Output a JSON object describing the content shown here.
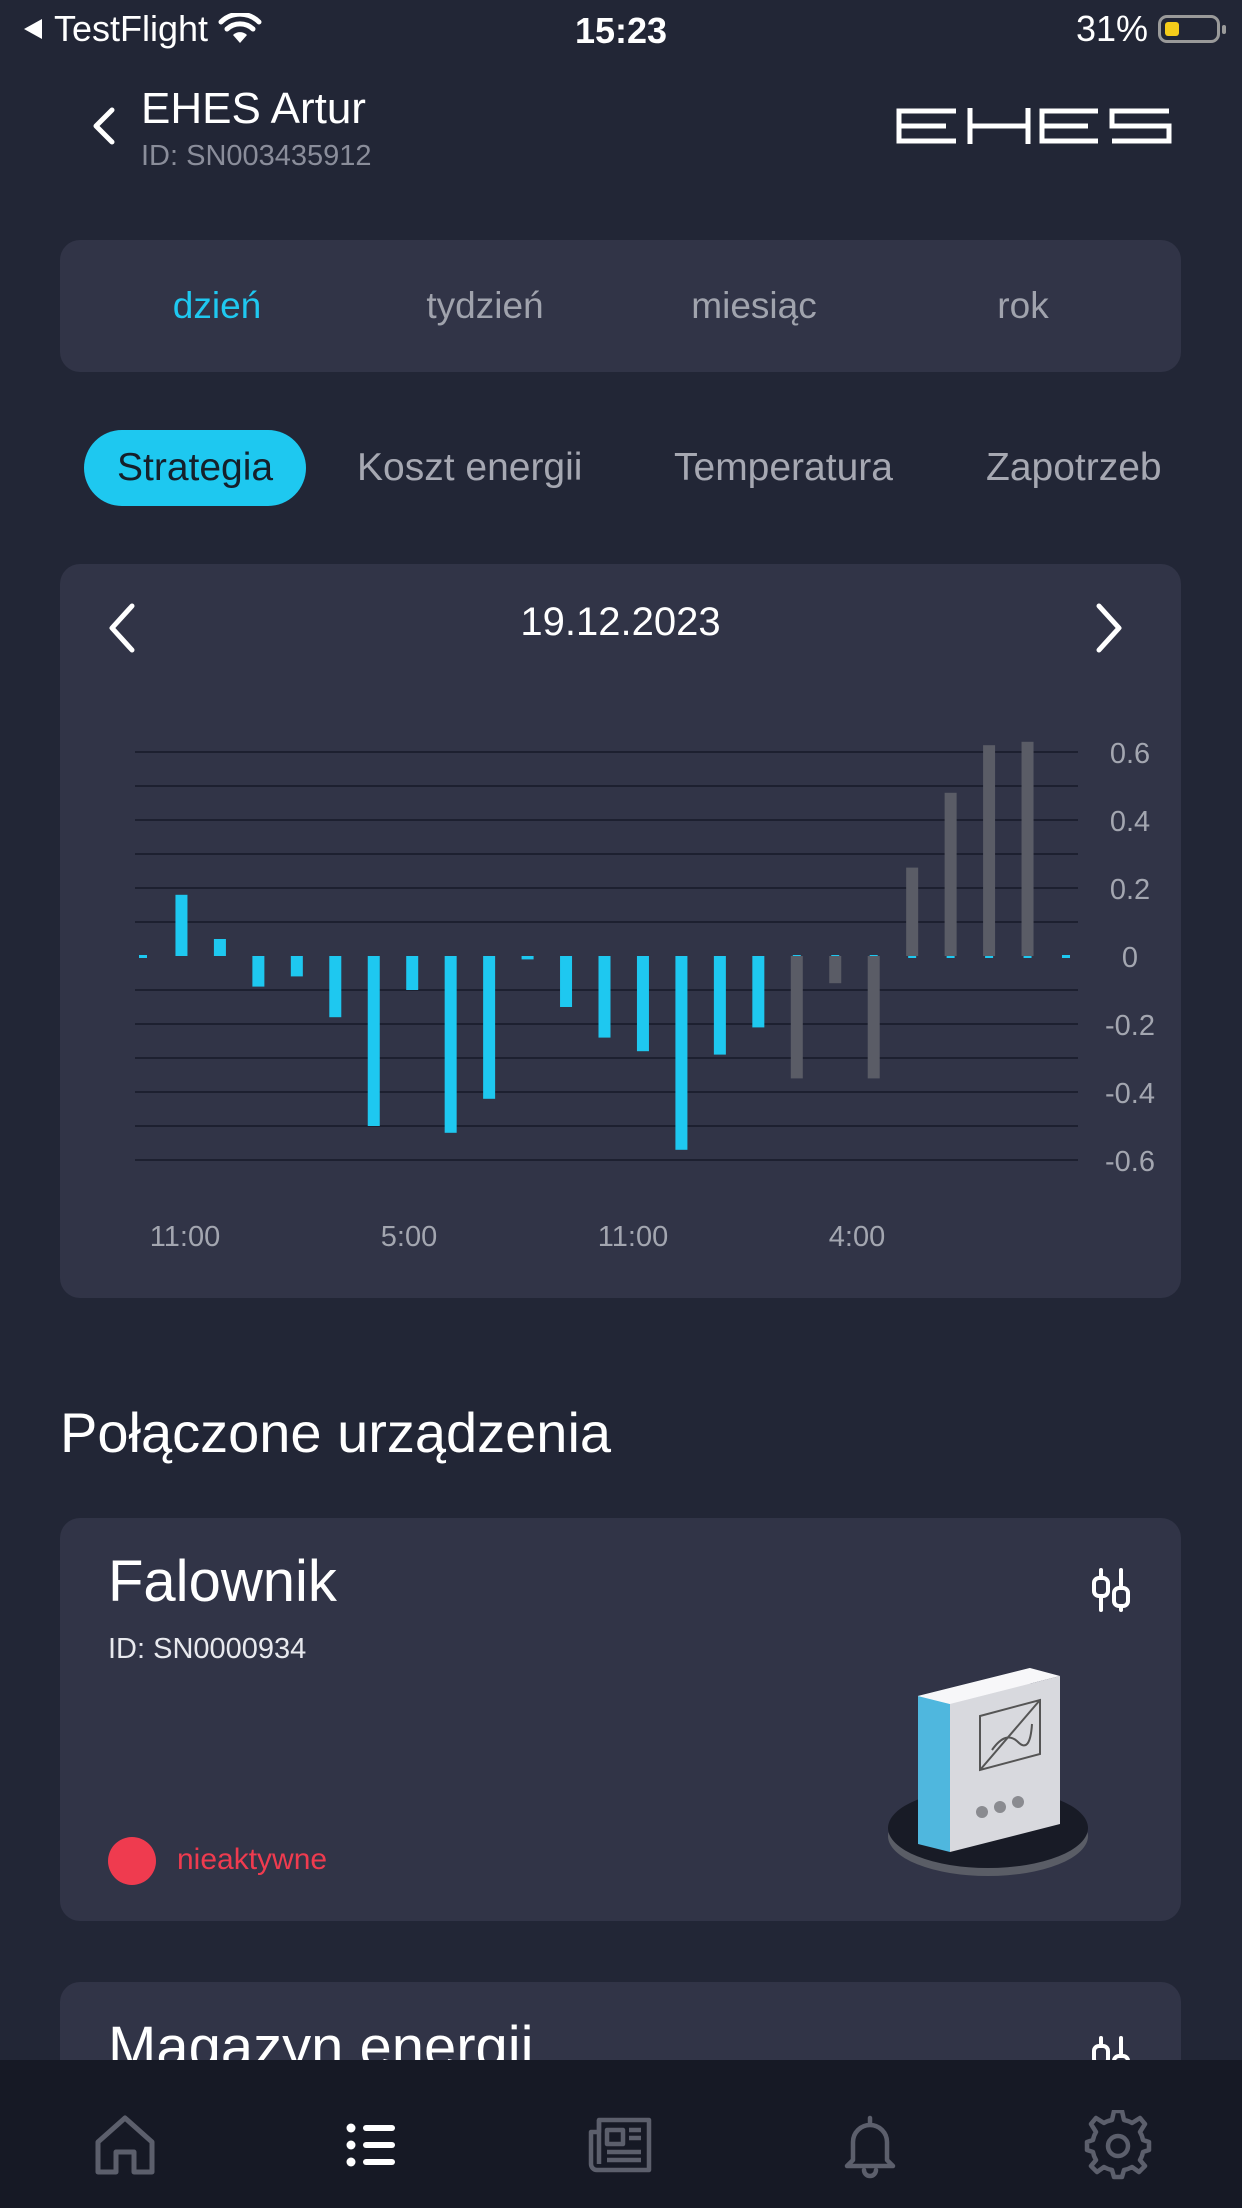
{
  "status_bar": {
    "back_app": "TestFlight",
    "time": "15:23",
    "battery": "31%",
    "battery_level": 0.31
  },
  "header": {
    "title": "EHES Artur",
    "device_id": "ID: SN003435912",
    "logo_text": "EHES"
  },
  "period_tabs": {
    "items": [
      "dzień",
      "tydzień",
      "miesiąc",
      "rok"
    ],
    "active": "dzień"
  },
  "chips": {
    "items": [
      "Strategia",
      "Koszt energii",
      "Temperatura",
      "Zapotrzeb"
    ],
    "active": "Strategia"
  },
  "chart_data": {
    "type": "bar",
    "date": "19.12.2023",
    "x_tick_labels": [
      "11:00",
      "5:00",
      "11:00",
      "4:00"
    ],
    "y_tick_labels": [
      "0.6",
      "0.4",
      "0.2",
      "0",
      "-0.2",
      "-0.4",
      "-0.6"
    ],
    "ylim": [
      -0.6,
      0.6
    ],
    "grid": true,
    "series": [
      {
        "color": "#1ec8f0",
        "values": [
          0,
          0.18,
          0.05,
          -0.09,
          -0.06,
          -0.18,
          -0.5,
          -0.1,
          -0.52,
          -0.42,
          -0.01,
          -0.15,
          -0.24,
          -0.28,
          -0.57,
          -0.29,
          -0.21,
          0,
          0,
          0,
          0,
          0,
          0,
          0,
          0
        ]
      },
      {
        "color": "#5a5c66",
        "values": [
          0,
          0,
          0,
          0,
          0,
          0,
          0,
          0,
          0,
          0,
          0,
          0,
          0,
          0,
          0,
          0,
          0,
          -0.36,
          -0.08,
          -0.36,
          0.26,
          0.48,
          0.62,
          0.63,
          0
        ]
      }
    ]
  },
  "connected_devices": {
    "title": "Połączone urządzenia",
    "devices": [
      {
        "name": "Falownik",
        "id": "ID: SN0000934",
        "status": "nieaktywne",
        "status_color": "#ef3b4f"
      },
      {
        "name": "Magazyn energii"
      }
    ]
  },
  "bottom_nav": {
    "items": [
      "home-icon",
      "list-icon",
      "news-icon",
      "bell-icon",
      "gear-icon"
    ],
    "active": "list-icon"
  }
}
